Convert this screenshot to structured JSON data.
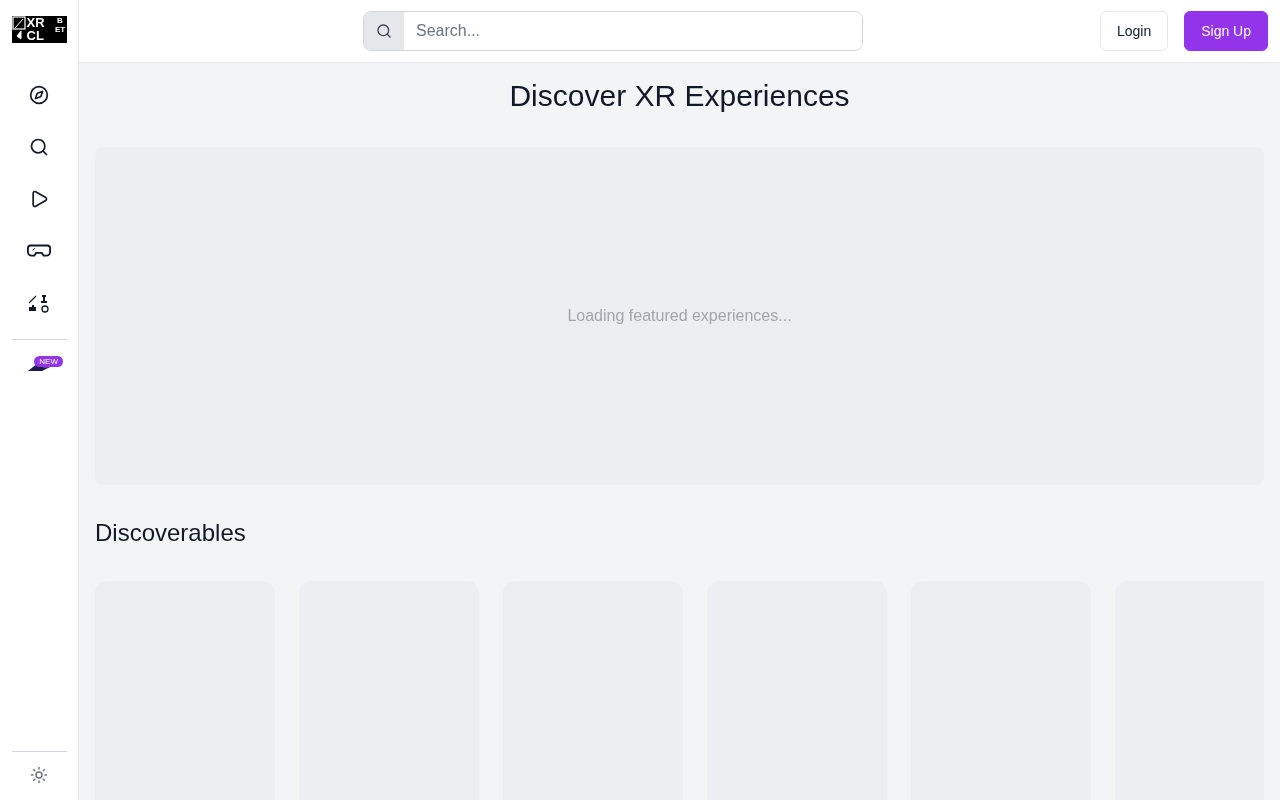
{
  "logo": {
    "lines": [
      "XR",
      "CL"
    ],
    "side": "BET"
  },
  "sidebar": {
    "items": [
      {
        "kind": "explore"
      },
      {
        "kind": "search"
      },
      {
        "kind": "play"
      },
      {
        "kind": "headset"
      },
      {
        "kind": "games"
      }
    ],
    "extra": {
      "kind": "hat",
      "badge": "NEW"
    },
    "footer": {
      "kind": "theme"
    }
  },
  "header": {
    "search": {
      "placeholder": "Search..."
    },
    "login": "Login",
    "signup": "Sign Up"
  },
  "title": "Discover XR Experiences",
  "featured": {
    "status": "Loading featured experiences..."
  },
  "discoverables": {
    "title": "Discoverables",
    "cards": [
      {
        "kind": "placeholder"
      },
      {
        "kind": "placeholder"
      },
      {
        "kind": "placeholder"
      },
      {
        "kind": "placeholder"
      },
      {
        "kind": "placeholder"
      },
      {
        "kind": "placeholder"
      }
    ]
  }
}
